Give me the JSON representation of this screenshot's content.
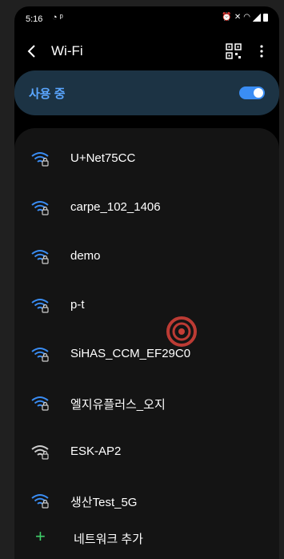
{
  "status_bar": {
    "time": "5:16",
    "left_icons": [
      "whatsapp-icon",
      "notification-icon"
    ],
    "right_icons": [
      "alarm-icon",
      "mute-icon",
      "wifi-status-icon",
      "signal-icon",
      "battery-icon"
    ]
  },
  "header": {
    "title": "Wi-Fi"
  },
  "wifi_toggle": {
    "label": "사용 중",
    "state": "on"
  },
  "networks": [
    {
      "name": "U+Net75CC"
    },
    {
      "name": "carpe_102_1406"
    },
    {
      "name": "demo"
    },
    {
      "name": "p-t"
    },
    {
      "name": "SiHAS_CCM_EF29C0"
    },
    {
      "name": "엘지유플러스_오지"
    },
    {
      "name": "ESK-AP2"
    },
    {
      "name": "생산Test_5G"
    }
  ],
  "add_network": {
    "icon": "+",
    "label": "네트워크 추가"
  },
  "colors": {
    "accent": "#3a8df4",
    "wifi_strong": "#3a8df4",
    "add_icon": "#3fcf6a"
  }
}
